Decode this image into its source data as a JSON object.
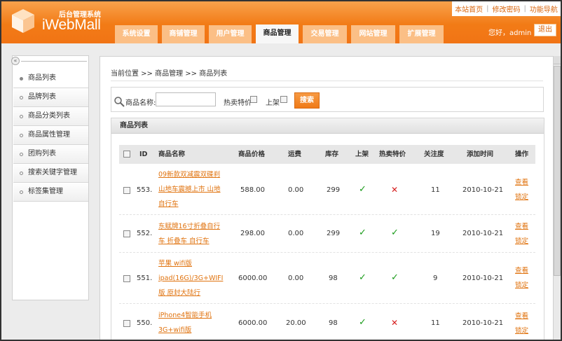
{
  "header": {
    "logo_subtitle": "后台管理系统",
    "logo_title": "iWebMall",
    "top_links": [
      "本站首页",
      "修改密码",
      "功能导航"
    ],
    "nav": [
      {
        "label": "系统设置",
        "active": false
      },
      {
        "label": "商铺管理",
        "active": false
      },
      {
        "label": "用户管理",
        "active": false
      },
      {
        "label": "商品管理",
        "active": true
      },
      {
        "label": "交易管理",
        "active": false
      },
      {
        "label": "网站管理",
        "active": false
      },
      {
        "label": "扩展管理",
        "active": false
      }
    ],
    "greeting": "您好，admin",
    "logout": "退出"
  },
  "sidebar": {
    "collapse_glyph": "«",
    "items": [
      {
        "label": "商品列表",
        "active": true
      },
      {
        "label": "品牌列表",
        "active": false
      },
      {
        "label": "商品分类列表",
        "active": false
      },
      {
        "label": "商品属性管理",
        "active": false
      },
      {
        "label": "团购列表",
        "active": false
      },
      {
        "label": "搜索关键字管理",
        "active": false
      },
      {
        "label": "标签集管理",
        "active": false
      }
    ]
  },
  "breadcrumb": {
    "text": "当前位置 >> 商品管理 >> 商品列表"
  },
  "search": {
    "name_label": "商品名称:",
    "name_value": "",
    "hot_label": "热卖特价",
    "onsale_label": "上架",
    "button": "搜索"
  },
  "panel": {
    "title": "商品列表"
  },
  "table": {
    "headers": [
      "ID",
      "商品名称",
      "商品价格",
      "运费",
      "库存",
      "上架",
      "热卖特价",
      "关注度",
      "添加时间",
      "操作"
    ],
    "rows": [
      {
        "id": "553.",
        "name_lines": [
          "09新款双减震双碟刹",
          "山地车震撼上市 山地",
          "自行车"
        ],
        "price": "588.00",
        "freight": "0.00",
        "stock": "299",
        "onsale": true,
        "hot": false,
        "attention": "11",
        "date": "2010-10-21",
        "actions": [
          "查看",
          "锁定"
        ]
      },
      {
        "id": "552.",
        "name_lines": [
          "东赋牌16寸折叠自行",
          "车 折叠车 自行车"
        ],
        "price": "298.00",
        "freight": "0.00",
        "stock": "299",
        "onsale": true,
        "hot": true,
        "attention": "19",
        "date": "2010-10-21",
        "actions": [
          "查看",
          "锁定"
        ]
      },
      {
        "id": "551.",
        "name_lines": [
          "苹果 wifi版",
          "ipad(16G)/3G+WIFI",
          "版 原封大陆行"
        ],
        "price": "6000.00",
        "freight": "0.00",
        "stock": "98",
        "onsale": true,
        "hot": true,
        "attention": "9",
        "date": "2010-10-21",
        "actions": [
          "查看",
          "锁定"
        ]
      },
      {
        "id": "550.",
        "name_lines": [
          "iPhone4智能手机",
          "3G+wifi版"
        ],
        "price": "6000.00",
        "freight": "20.00",
        "stock": "98",
        "onsale": true,
        "hot": false,
        "attention": "11",
        "date": "2010-10-21",
        "actions": [
          "查看",
          "锁定"
        ]
      }
    ],
    "yes_glyph": "✓",
    "no_glyph": "✕"
  },
  "colors": {
    "brand_orange": "#f27b16",
    "link_orange": "#e0730f",
    "yes_green": "#1a9b1a",
    "no_red": "#d62020"
  }
}
